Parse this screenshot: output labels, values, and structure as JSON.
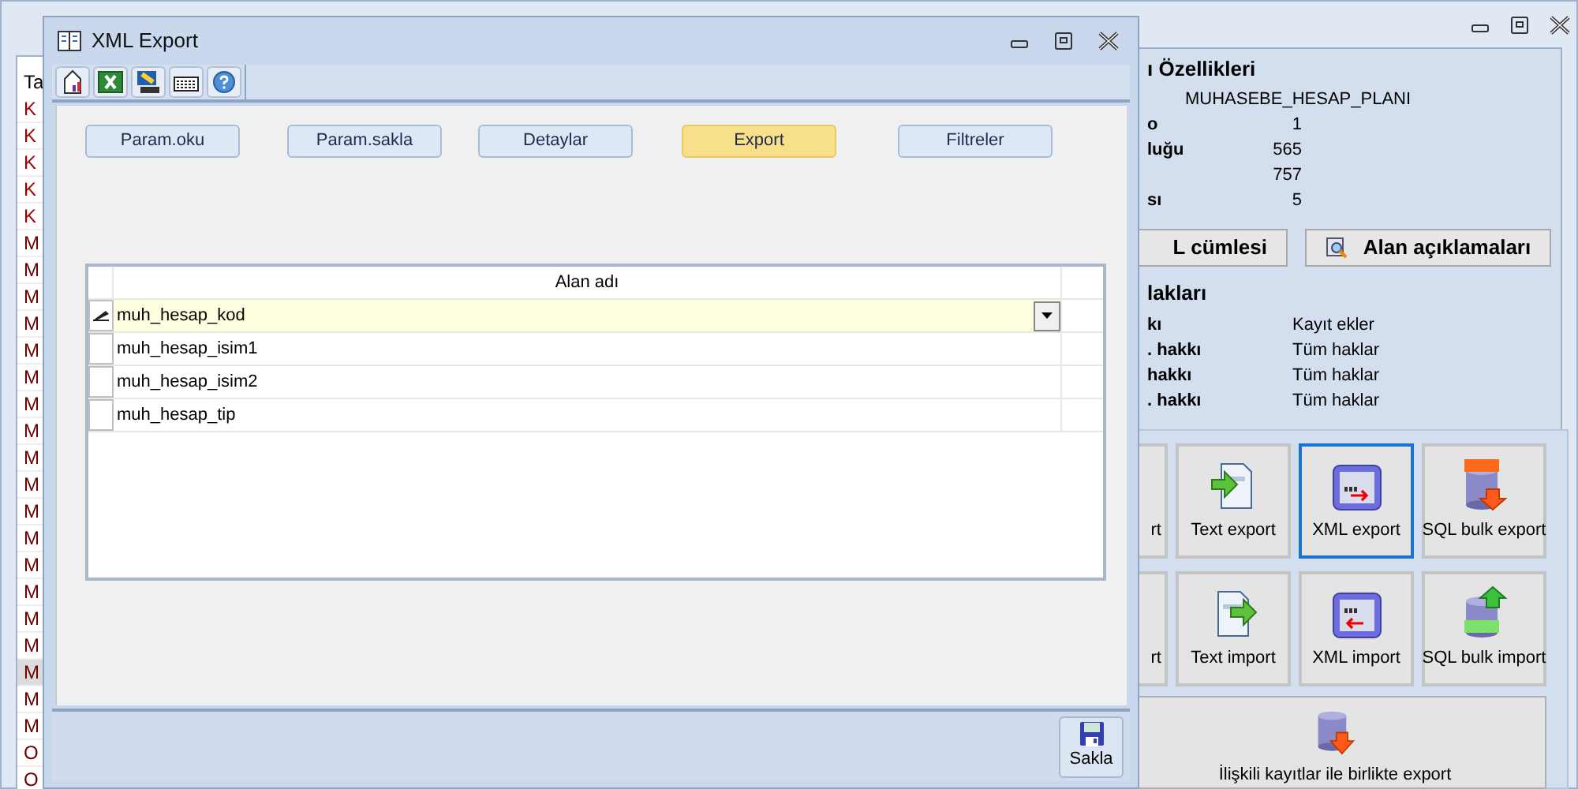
{
  "background_window": {
    "list": {
      "header": "Ta",
      "items": [
        {
          "label": "K",
          "color": "#990000",
          "selected": false
        },
        {
          "label": "K",
          "color": "#990000",
          "selected": false
        },
        {
          "label": "K",
          "color": "#990000",
          "selected": false
        },
        {
          "label": "K",
          "color": "#990000",
          "selected": false
        },
        {
          "label": "K",
          "color": "#990000",
          "selected": false
        },
        {
          "label": "M",
          "color": "#660000",
          "selected": false
        },
        {
          "label": "M",
          "color": "#660000",
          "selected": false
        },
        {
          "label": "M",
          "color": "#660000",
          "selected": false
        },
        {
          "label": "M",
          "color": "#660000",
          "selected": false
        },
        {
          "label": "M",
          "color": "#660000",
          "selected": false
        },
        {
          "label": "M",
          "color": "#660000",
          "selected": false
        },
        {
          "label": "M",
          "color": "#660000",
          "selected": false
        },
        {
          "label": "M",
          "color": "#660000",
          "selected": false
        },
        {
          "label": "M",
          "color": "#660000",
          "selected": false
        },
        {
          "label": "M",
          "color": "#660000",
          "selected": false
        },
        {
          "label": "M",
          "color": "#660000",
          "selected": false
        },
        {
          "label": "M",
          "color": "#660000",
          "selected": false
        },
        {
          "label": "M",
          "color": "#660000",
          "selected": false
        },
        {
          "label": "M",
          "color": "#660000",
          "selected": false
        },
        {
          "label": "M",
          "color": "#660000",
          "selected": false
        },
        {
          "label": "M",
          "color": "#660000",
          "selected": false
        },
        {
          "label": "M",
          "color": "#660000",
          "selected": true
        },
        {
          "label": "M",
          "color": "#660000",
          "selected": false
        },
        {
          "label": "M",
          "color": "#660000",
          "selected": false
        },
        {
          "label": "O",
          "color": "#660000",
          "selected": false
        },
        {
          "label": "O",
          "color": "#660000",
          "selected": false
        }
      ]
    },
    "properties": {
      "title": "ı Özellikleri",
      "rows": [
        {
          "value": "MUHASEBE_HESAP_PLANI"
        },
        {
          "label": "o",
          "value": "1"
        },
        {
          "label": "luğu",
          "value": "565"
        },
        {
          "value": "757"
        },
        {
          "label": "sı",
          "value": "5"
        }
      ]
    },
    "buttons": [
      {
        "label": "L cümlesi",
        "kind": "plain"
      },
      {
        "label": "Alan açıklamaları",
        "kind": "inspect"
      }
    ],
    "rights": {
      "title": "lakları",
      "rows": [
        {
          "label": "kı",
          "value": "Kayıt ekler"
        },
        {
          "label": ". hakkı",
          "value": "Tüm haklar"
        },
        {
          "label": "hakkı",
          "value": "Tüm haklar"
        },
        {
          "label": ". hakkı",
          "value": "Tüm haklar"
        }
      ]
    },
    "tiles": [
      {
        "label": "rt",
        "kind": "partial",
        "selected": false
      },
      {
        "label": "Text export",
        "kind": "text-export",
        "selected": false
      },
      {
        "label": "XML export",
        "kind": "xml-export",
        "selected": true
      },
      {
        "label": "SQL bulk export",
        "kind": "sql-export",
        "selected": false
      },
      {
        "label": "rt",
        "kind": "partial",
        "selected": false
      },
      {
        "label": "Text import",
        "kind": "text-import",
        "selected": false
      },
      {
        "label": "XML import",
        "kind": "xml-import",
        "selected": false
      },
      {
        "label": "SQL bulk import",
        "kind": "sql-import",
        "selected": false
      }
    ],
    "wide_tile": {
      "label": "İlişkili kayıtlar ile birlikte export"
    }
  },
  "dialog": {
    "title": "XML Export",
    "buttons": [
      {
        "label": "Param.oku",
        "selected": false
      },
      {
        "label": "Param.sakla",
        "selected": false
      },
      {
        "label": "Detaylar",
        "selected": false
      },
      {
        "label": "Export",
        "selected": true
      },
      {
        "label": "Filtreler",
        "selected": false
      }
    ],
    "grid": {
      "header": "Alan adı",
      "rows": [
        {
          "value": "muh_hesap_kod",
          "selected": true
        },
        {
          "value": "muh_hesap_isim1",
          "selected": false
        },
        {
          "value": "muh_hesap_isim2",
          "selected": false
        },
        {
          "value": "muh_hesap_tip",
          "selected": false
        }
      ]
    },
    "save_button": "Sakla"
  }
}
